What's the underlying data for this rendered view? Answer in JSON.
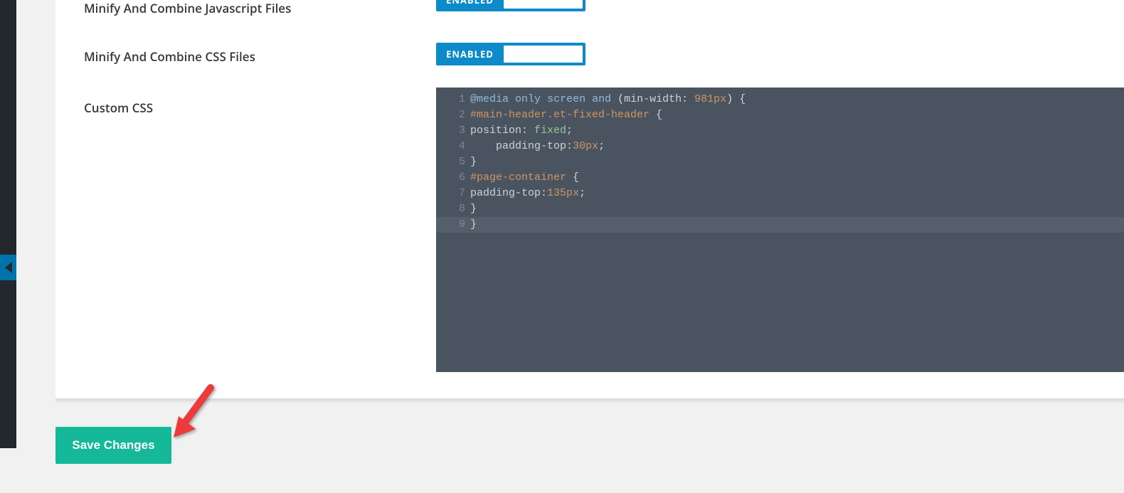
{
  "settings": {
    "minify_js": {
      "label": "Minify And Combine Javascript Files",
      "state_text": "ENABLED"
    },
    "minify_css": {
      "label": "Minify And Combine CSS Files",
      "state_text": "ENABLED"
    },
    "custom_css": {
      "label": "Custom CSS"
    }
  },
  "code": {
    "line_count": 9,
    "active_line_index": 8,
    "lines_raw": [
      "@media only screen and (min-width: 981px) {",
      "#main-header.et-fixed-header {",
      "position: fixed;",
      "    padding-top:30px;",
      "}",
      "#page-container {",
      "padding-top:135px;",
      "}",
      "}"
    ],
    "lines": [
      [
        {
          "t": "@media",
          "c": "tok-blue"
        },
        {
          "t": " ",
          "c": ""
        },
        {
          "t": "only",
          "c": "tok-blue"
        },
        {
          "t": " ",
          "c": ""
        },
        {
          "t": "screen",
          "c": "tok-blue"
        },
        {
          "t": " ",
          "c": ""
        },
        {
          "t": "and",
          "c": "tok-blue"
        },
        {
          "t": " ",
          "c": ""
        },
        {
          "t": "(",
          "c": "tok-paren"
        },
        {
          "t": "min-width",
          "c": "tok-prop"
        },
        {
          "t": ": ",
          "c": "tok-colon"
        },
        {
          "t": "981px",
          "c": "tok-num"
        },
        {
          "t": ")",
          "c": "tok-paren"
        },
        {
          "t": " {",
          "c": "tok-brace"
        }
      ],
      [
        {
          "t": "#main-header.et-fixed-header",
          "c": "tok-sel"
        },
        {
          "t": " {",
          "c": "tok-brace"
        }
      ],
      [
        {
          "t": "position",
          "c": "tok-prop"
        },
        {
          "t": ": ",
          "c": "tok-colon"
        },
        {
          "t": "fixed",
          "c": "tok-val"
        },
        {
          "t": ";",
          "c": "tok-dim"
        }
      ],
      [
        {
          "t": "    ",
          "c": ""
        },
        {
          "t": "padding-top",
          "c": "tok-prop"
        },
        {
          "t": ":",
          "c": "tok-colon"
        },
        {
          "t": "30px",
          "c": "tok-num"
        },
        {
          "t": ";",
          "c": "tok-dim"
        }
      ],
      [
        {
          "t": "}",
          "c": "tok-brace"
        }
      ],
      [
        {
          "t": "#page-container",
          "c": "tok-sel"
        },
        {
          "t": " {",
          "c": "tok-brace"
        }
      ],
      [
        {
          "t": "padding-top",
          "c": "tok-prop"
        },
        {
          "t": ":",
          "c": "tok-colon"
        },
        {
          "t": "135px",
          "c": "tok-num"
        },
        {
          "t": ";",
          "c": "tok-dim"
        }
      ],
      [
        {
          "t": "}",
          "c": "tok-brace"
        }
      ],
      [
        {
          "t": "}",
          "c": "tok-brace"
        }
      ]
    ]
  },
  "actions": {
    "save_label": "Save Changes"
  }
}
